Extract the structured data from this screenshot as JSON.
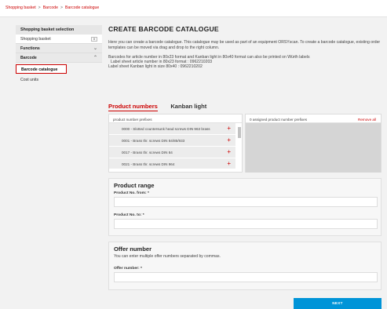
{
  "breadcrumb": [
    "Shopping basket",
    "Barcode",
    "Barcode catalogue"
  ],
  "sidebar": {
    "header": "Shopping basket selection",
    "basket_label": "Shopping basket",
    "basket_count": "0",
    "functions_label": "Functions",
    "barcode_label": "Barcode",
    "catalogue_label": "Barcode catalogue",
    "cost_units_label": "Cost units"
  },
  "main": {
    "title": "CREATE BARCODE CATALOGUE",
    "intro": "Here you can create a barcode catalogue. This catalogue may be used as part of an equipment ORSYscan. To create a barcode catalogue, existing order templates can be moved via drag and drop to the right column.",
    "info1": "Barcodes for article number in 80x23 format and Kanban light in 80x40 format can also be printed on Würth labels",
    "info2": "Label sheet article number in 80x23 format : 0962210203",
    "info3": "Label sheet Kanban light in size 80x40 : 0962210202"
  },
  "tabs": {
    "product_numbers": "Product numbers",
    "kanban_light": "Kanban light"
  },
  "left_panel": {
    "header": "product number prefixes",
    "items": [
      "0000 - Slotted countersunk head screws DIN 963 brass",
      "0001 - Brass thr. screws DIN 84/85/933",
      "0017 - Brass thr. screws DIN 84",
      "0021 - Brass thr. screws DIN 964"
    ]
  },
  "right_panel": {
    "header": "0 assigned product number prefixes",
    "remove_all": "Remove all"
  },
  "product_range": {
    "title": "Product range",
    "from_label": "Product No. from:",
    "to_label": "Product No. to:",
    "required_mark": "*"
  },
  "offer": {
    "title": "Offer number",
    "hint": "You can enter multiple offer numbers separated by commas.",
    "label": "Offer number:"
  },
  "next_label": "NEXT"
}
